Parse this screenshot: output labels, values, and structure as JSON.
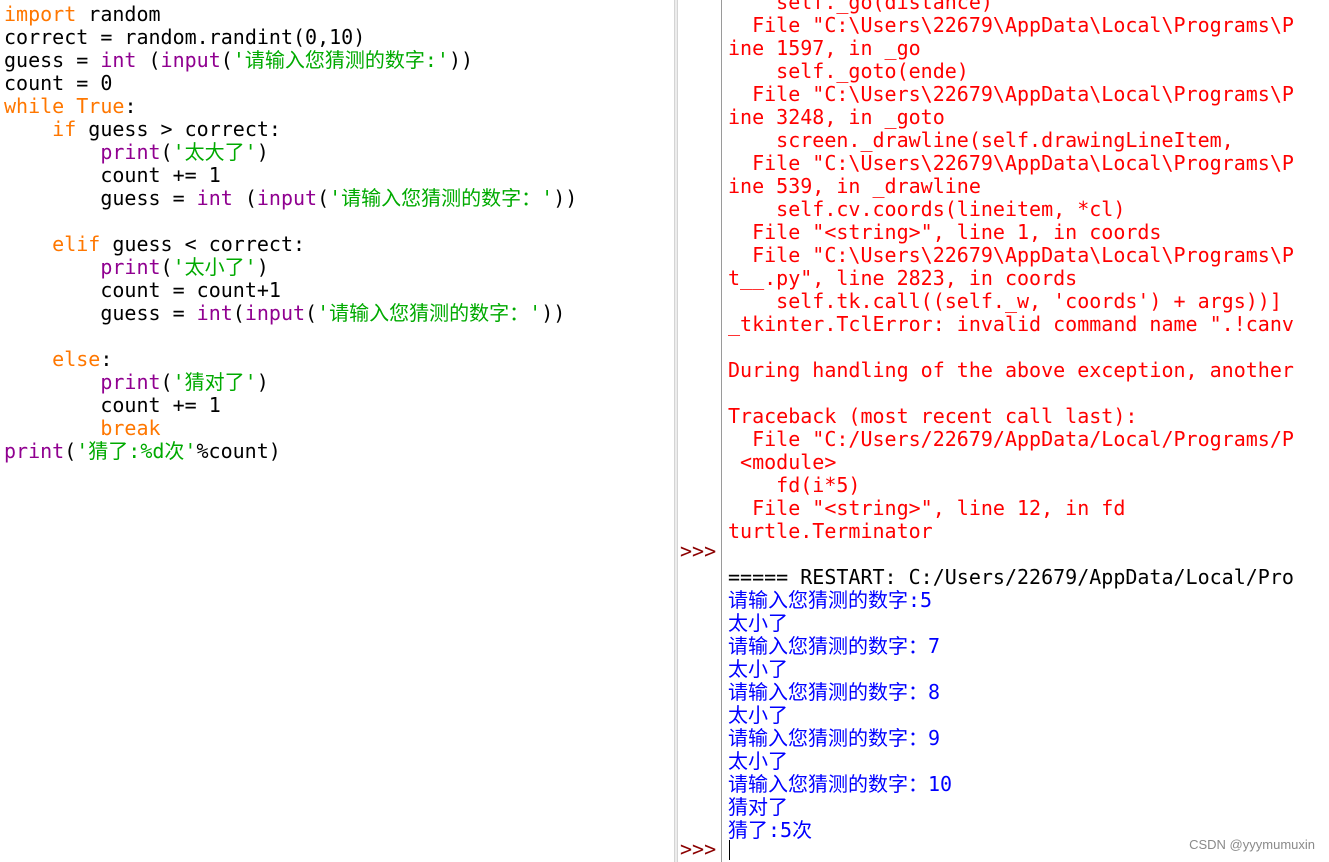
{
  "editor": {
    "lines": [
      [
        {
          "t": "import",
          "c": "kw"
        },
        {
          "t": " random",
          "c": ""
        }
      ],
      [
        {
          "t": "correct = random.randint(0,10)",
          "c": ""
        }
      ],
      [
        {
          "t": "guess = ",
          "c": ""
        },
        {
          "t": "int",
          "c": "bi"
        },
        {
          "t": " (",
          "c": ""
        },
        {
          "t": "input",
          "c": "bi"
        },
        {
          "t": "(",
          "c": ""
        },
        {
          "t": "'请输入您猜测的数字:'",
          "c": "str"
        },
        {
          "t": "))",
          "c": ""
        }
      ],
      [
        {
          "t": "count = 0",
          "c": ""
        }
      ],
      [
        {
          "t": "while",
          "c": "kw"
        },
        {
          "t": " ",
          "c": ""
        },
        {
          "t": "True",
          "c": "kw"
        },
        {
          "t": ":",
          "c": ""
        }
      ],
      [
        {
          "t": "    ",
          "c": ""
        },
        {
          "t": "if",
          "c": "kw"
        },
        {
          "t": " guess > correct:",
          "c": ""
        }
      ],
      [
        {
          "t": "        ",
          "c": ""
        },
        {
          "t": "print",
          "c": "bi"
        },
        {
          "t": "(",
          "c": ""
        },
        {
          "t": "'太大了'",
          "c": "str"
        },
        {
          "t": ")",
          "c": ""
        }
      ],
      [
        {
          "t": "        count += 1",
          "c": ""
        }
      ],
      [
        {
          "t": "        guess = ",
          "c": ""
        },
        {
          "t": "int",
          "c": "bi"
        },
        {
          "t": " (",
          "c": ""
        },
        {
          "t": "input",
          "c": "bi"
        },
        {
          "t": "(",
          "c": ""
        },
        {
          "t": "'请输入您猜测的数字：'",
          "c": "str"
        },
        {
          "t": "))",
          "c": ""
        }
      ],
      [],
      [
        {
          "t": "    ",
          "c": ""
        },
        {
          "t": "elif",
          "c": "kw"
        },
        {
          "t": " guess < correct:",
          "c": ""
        }
      ],
      [
        {
          "t": "        ",
          "c": ""
        },
        {
          "t": "print",
          "c": "bi"
        },
        {
          "t": "(",
          "c": ""
        },
        {
          "t": "'太小了'",
          "c": "str"
        },
        {
          "t": ")",
          "c": ""
        }
      ],
      [
        {
          "t": "        count = count+1",
          "c": ""
        }
      ],
      [
        {
          "t": "        guess = ",
          "c": ""
        },
        {
          "t": "int",
          "c": "bi"
        },
        {
          "t": "(",
          "c": ""
        },
        {
          "t": "input",
          "c": "bi"
        },
        {
          "t": "(",
          "c": ""
        },
        {
          "t": "'请输入您猜测的数字：'",
          "c": "str"
        },
        {
          "t": "))",
          "c": ""
        }
      ],
      [],
      [
        {
          "t": "    ",
          "c": ""
        },
        {
          "t": "else",
          "c": "kw"
        },
        {
          "t": ":",
          "c": ""
        }
      ],
      [
        {
          "t": "        ",
          "c": ""
        },
        {
          "t": "print",
          "c": "bi"
        },
        {
          "t": "(",
          "c": ""
        },
        {
          "t": "'猜对了'",
          "c": "str"
        },
        {
          "t": ")",
          "c": ""
        }
      ],
      [
        {
          "t": "        count += 1",
          "c": ""
        }
      ],
      [
        {
          "t": "        ",
          "c": ""
        },
        {
          "t": "break",
          "c": "kw"
        }
      ],
      [
        {
          "t": "print",
          "c": "bi"
        },
        {
          "t": "(",
          "c": ""
        },
        {
          "t": "'猜了:%d次'",
          "c": "str"
        },
        {
          "t": "%count)",
          "c": ""
        }
      ]
    ]
  },
  "shell": {
    "prompt_symbol": ">>>",
    "lines": [
      {
        "t": "    self._go(distance)",
        "c": "err"
      },
      {
        "t": "  File \"C:\\Users\\22679\\AppData\\Local\\Programs\\P",
        "c": "err"
      },
      {
        "t": "ine 1597, in _go",
        "c": "err"
      },
      {
        "t": "    self._goto(ende)",
        "c": "err"
      },
      {
        "t": "  File \"C:\\Users\\22679\\AppData\\Local\\Programs\\P",
        "c": "err"
      },
      {
        "t": "ine 3248, in _goto",
        "c": "err"
      },
      {
        "t": "    screen._drawline(self.drawingLineItem,",
        "c": "err"
      },
      {
        "t": "  File \"C:\\Users\\22679\\AppData\\Local\\Programs\\P",
        "c": "err"
      },
      {
        "t": "ine 539, in _drawline",
        "c": "err"
      },
      {
        "t": "    self.cv.coords(lineitem, *cl)",
        "c": "err"
      },
      {
        "t": "  File \"<string>\", line 1, in coords",
        "c": "err"
      },
      {
        "t": "  File \"C:\\Users\\22679\\AppData\\Local\\Programs\\P",
        "c": "err"
      },
      {
        "t": "t__.py\", line 2823, in coords",
        "c": "err"
      },
      {
        "t": "    self.tk.call((self._w, 'coords') + args))]",
        "c": "err"
      },
      {
        "t": "_tkinter.TclError: invalid command name \".!canv",
        "c": "err"
      },
      {
        "t": "",
        "c": "err"
      },
      {
        "t": "During handling of the above exception, another",
        "c": "err"
      },
      {
        "t": "",
        "c": "err"
      },
      {
        "t": "Traceback (most recent call last):",
        "c": "err"
      },
      {
        "t": "  File \"C:/Users/22679/AppData/Local/Programs/P",
        "c": "err"
      },
      {
        "t": " <module>",
        "c": "err"
      },
      {
        "t": "    fd(i*5)",
        "c": "err"
      },
      {
        "t": "  File \"<string>\", line 12, in fd",
        "c": "err"
      },
      {
        "t": "turtle.Terminator",
        "c": "err"
      },
      {
        "t": "",
        "c": "plain"
      },
      {
        "t": "===== RESTART: C:/Users/22679/AppData/Local/Pro",
        "c": "plain"
      },
      {
        "t": "请输入您猜测的数字:5",
        "c": "out"
      },
      {
        "t": "太小了",
        "c": "out"
      },
      {
        "t": "请输入您猜测的数字：7",
        "c": "out"
      },
      {
        "t": "太小了",
        "c": "out"
      },
      {
        "t": "请输入您猜测的数字：8",
        "c": "out"
      },
      {
        "t": "太小了",
        "c": "out"
      },
      {
        "t": "请输入您猜测的数字：9",
        "c": "out"
      },
      {
        "t": "太小了",
        "c": "out"
      },
      {
        "t": "请输入您猜测的数字：10",
        "c": "out"
      },
      {
        "t": "猜对了",
        "c": "out"
      },
      {
        "t": "猜了:5次",
        "c": "out"
      }
    ]
  },
  "watermark": "CSDN @yyymumuxin"
}
